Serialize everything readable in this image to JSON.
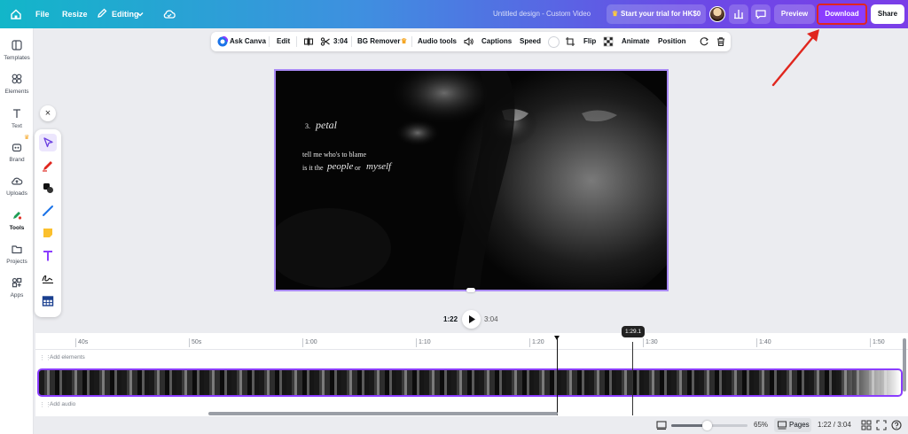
{
  "topbar": {
    "file": "File",
    "resize": "Resize",
    "editing": "Editing",
    "doc_title": "Untitled design - Custom Video",
    "trial": "Start your trial for HK$0",
    "preview": "Preview",
    "download": "Download",
    "share": "Share"
  },
  "leftnav": {
    "items": [
      {
        "label": "Templates",
        "icon": "templates-icon"
      },
      {
        "label": "Elements",
        "icon": "elements-icon"
      },
      {
        "label": "Text",
        "icon": "text-icon"
      },
      {
        "label": "Brand",
        "icon": "brand-icon"
      },
      {
        "label": "Uploads",
        "icon": "uploads-icon"
      },
      {
        "label": "Tools",
        "icon": "tools-icon"
      },
      {
        "label": "Projects",
        "icon": "projects-icon"
      },
      {
        "label": "Apps",
        "icon": "apps-icon"
      }
    ]
  },
  "palette": {
    "tools": [
      "select-pointer-icon",
      "pen-icon",
      "shape-icon",
      "line-icon",
      "sticky-note-icon",
      "text-tool-icon",
      "signature-icon",
      "table-icon"
    ]
  },
  "toolbar": {
    "ask_canva": "Ask Canva",
    "edit": "Edit",
    "duration": "3:04",
    "bg_remover": "BG Remover",
    "audio_tools": "Audio tools",
    "captions": "Captions",
    "speed": "Speed",
    "flip": "Flip",
    "animate": "Animate",
    "position": "Position"
  },
  "canvas": {
    "line1_num": "3.",
    "line1_word": "petal",
    "line2": "tell me who's to blame",
    "line3_a": "is it the",
    "line3_b": "people",
    "line3_c": "or",
    "line3_d": "myself"
  },
  "playback": {
    "current": "1:22",
    "total": "3:04"
  },
  "timeline": {
    "ticks": [
      "40s",
      "50s",
      "1:00",
      "1:10",
      "1:20",
      "1:30",
      "1:40",
      "1:50"
    ],
    "hover_time": "1:29.1",
    "add_elements": "Add elements",
    "add_audio": "Add audio"
  },
  "bottombar": {
    "zoom": "65%",
    "pages": "Pages",
    "time": "1:22 / 3:04"
  },
  "colors": {
    "accent": "#8b3dff",
    "highlight": "#e0261e"
  }
}
